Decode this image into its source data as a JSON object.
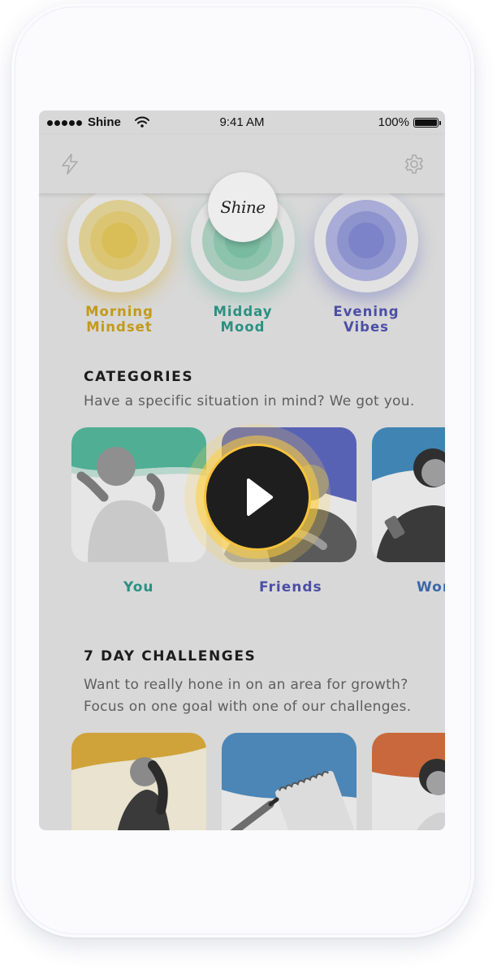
{
  "status_bar": {
    "carrier": "Shine",
    "time": "9:41 AM",
    "battery": "100%"
  },
  "nav": {
    "left_icon": "lightning-icon",
    "right_icon": "gear-icon",
    "logo_text": "Shine"
  },
  "daily": [
    {
      "label": "Morning\nMindset",
      "color": "#c39a1b"
    },
    {
      "label": "Midday\nMood",
      "color": "#2a9182"
    },
    {
      "label": "Evening\nVibes",
      "color": "#4c4fa6"
    }
  ],
  "categories": {
    "title": "CATEGORIES",
    "subtitle": "Have a specific situation in mind? We got you.",
    "items": [
      {
        "label": "You",
        "color": "#2a9182"
      },
      {
        "label": "Friends",
        "color": "#4c4fa6"
      },
      {
        "label": "Wor",
        "color": "#3b67a8"
      }
    ]
  },
  "challenges": {
    "title": "7 DAY CHALLENGES",
    "subtitle": "Want to really hone in on an area for growth? Focus on one goal with one of our challenges."
  },
  "play_button": {
    "icon": "play-icon",
    "accent": "#f6c33b"
  }
}
